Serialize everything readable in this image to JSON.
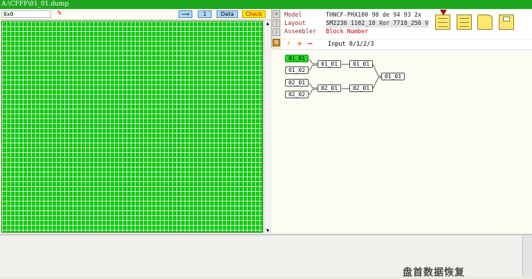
{
  "window": {
    "title": "A:\\CFFF\\01_01.dump"
  },
  "toolbar": {
    "address_value": "0x0",
    "percent_label": "%",
    "arrow_label": "⟶",
    "count_label": "1",
    "data_label": "Data",
    "check_label": "Check"
  },
  "info": {
    "rows": [
      {
        "label": "Model",
        "value": "THNCF-PHX100  98 de 94 93  2x"
      },
      {
        "label": "Layout",
        "value": "SM2236 1102_18 Xor 7718_256 V"
      },
      {
        "label": "Assembler",
        "value": "Block Number"
      }
    ]
  },
  "icons": {
    "sidebar": [
      "bar-chart-icon",
      "pin-icon",
      "marker-icon",
      "tree-icon"
    ],
    "big": [
      "load-dump-icon",
      "layers-icon",
      "folder-icon",
      "save-icon"
    ],
    "mini": [
      "wand-icon",
      "add-icon",
      "remove-icon"
    ]
  },
  "assembler": {
    "input_label": "Input 0/1/2/3",
    "nodes": {
      "in1": "01_01",
      "in2": "01_02",
      "in3": "02_01",
      "in4": "02_02",
      "m1": "01_01",
      "m2": "02_01",
      "r1": "01_01",
      "r2": "02_01",
      "out": "01_01"
    }
  },
  "colors": {
    "grid_fill": "#14c814",
    "title_bar": "#1fa61f",
    "check_bg": "#ffe800",
    "selected_node": "#22dd22"
  },
  "watermark": "盘首数据恢复"
}
